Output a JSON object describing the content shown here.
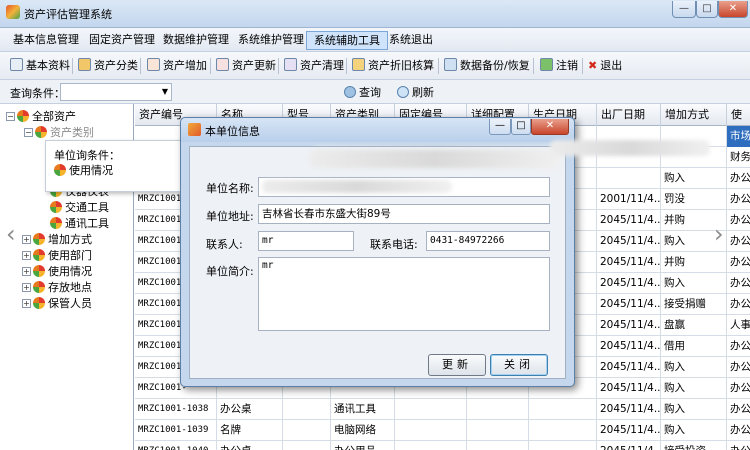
{
  "window": {
    "title": "资产评估管理系统",
    "min_label": "—",
    "max_label": "□",
    "close_label": "✕"
  },
  "menu": {
    "items": [
      "基本信息管理",
      "固定资产管理",
      "数据维护管理",
      "系统维护管理",
      "系统辅助工具",
      "系统退出"
    ],
    "active_index": 4
  },
  "toolbar": {
    "items": [
      "基本资料",
      "资产分类",
      "资产增加",
      "资产更新",
      "资产清理",
      "资产折旧核算",
      "数据备份/恢复",
      "注销",
      "退出"
    ]
  },
  "query": {
    "label": "查询条件：",
    "combo_value": "",
    "search_label": "查询",
    "refresh_label": "刷新"
  },
  "tree": {
    "root": "全部资产",
    "category_partial": "资产类别",
    "floating_label": "单位询条件：",
    "usage_label": "使用情况",
    "children": [
      "仪器仪表",
      "交通工具",
      "通讯工具"
    ],
    "groups": [
      "增加方式",
      "使用部门",
      "使用情况",
      "存放地点",
      "保管人员"
    ]
  },
  "grid": {
    "headers": [
      "资产编号",
      "名称",
      "型号",
      "资产类别",
      "固定编号",
      "详细配置",
      "生产日期",
      "出厂日期",
      "增加方式",
      "使"
    ],
    "rows": [
      {
        "id": "",
        "name": "",
        "cat": "",
        "date": "",
        "method": "",
        "use": "市场"
      },
      {
        "id": "MRZC1001",
        "name": "",
        "cat": "",
        "date": "",
        "method": "",
        "use": "财务"
      },
      {
        "id": "MRZC1001",
        "name": "",
        "cat": "",
        "date": "",
        "method": "购入",
        "use": "办公"
      },
      {
        "id": "MRZC1001-",
        "name": "",
        "cat": "",
        "date": "2001/11/4...",
        "method": "罚没",
        "use": "办公"
      },
      {
        "id": "MRZC1001-",
        "name": "",
        "cat": "",
        "date": "2045/11/4...",
        "method": "并购",
        "use": "办公"
      },
      {
        "id": "MRZC1001-",
        "name": "",
        "cat": "",
        "date": "2045/11/4...",
        "method": "购入",
        "use": "办公"
      },
      {
        "id": "MRZC1001-",
        "name": "",
        "cat": "",
        "date": "2045/11/4...",
        "method": "并购",
        "use": "办公"
      },
      {
        "id": "MRZC1001-",
        "name": "",
        "cat": "",
        "date": "2045/11/4...",
        "method": "购入",
        "use": "办公"
      },
      {
        "id": "MRZC1001-",
        "name": "",
        "cat": "",
        "date": "2045/11/4...",
        "method": "接受捐赠",
        "use": "办公"
      },
      {
        "id": "MRZC1001-",
        "name": "",
        "cat": "",
        "date": "2045/11/4...",
        "method": "盘赢",
        "use": "人事"
      },
      {
        "id": "MRZC1001-",
        "name": "",
        "cat": "",
        "date": "2045/11/4...",
        "method": "借用",
        "use": "办公"
      },
      {
        "id": "MRZC1001-",
        "name": "",
        "cat": "",
        "date": "2045/11/4...",
        "method": "购入",
        "use": "办公"
      },
      {
        "id": "MRZC1001-",
        "name": "",
        "cat": "",
        "date": "2045/11/4...",
        "method": "购入",
        "use": "办公"
      },
      {
        "id": "MRZC1001-1038",
        "name": "办公桌",
        "cat": "通讯工具",
        "date": "2045/11/4...",
        "method": "购入",
        "use": "办公"
      },
      {
        "id": "MRZC1001-1039",
        "name": "名牌",
        "cat": "电脑网络",
        "date": "2045/11/4...",
        "method": "购入",
        "use": "办公"
      },
      {
        "id": "MRZC1001-1040",
        "name": "办公桌",
        "cat": "办公用品",
        "date": "2045/11/4...",
        "method": "接受投资",
        "use": "办公"
      }
    ]
  },
  "dialog": {
    "title": "本单位信息",
    "name_label": "单位名称:",
    "name_value": "",
    "address_label": "单位地址:",
    "address_value": "吉林省长春市东盛大街89号",
    "contact_label": "联系人:",
    "contact_value": "mr",
    "phone_label": "联系电话:",
    "phone_value": "0431-84972266",
    "intro_label": "单位简介:",
    "intro_value": "mr",
    "update_button": "更新",
    "close_button": "关闭"
  },
  "colors": {
    "selection": "#2f6ebf",
    "accent": "#7ca6d6"
  }
}
